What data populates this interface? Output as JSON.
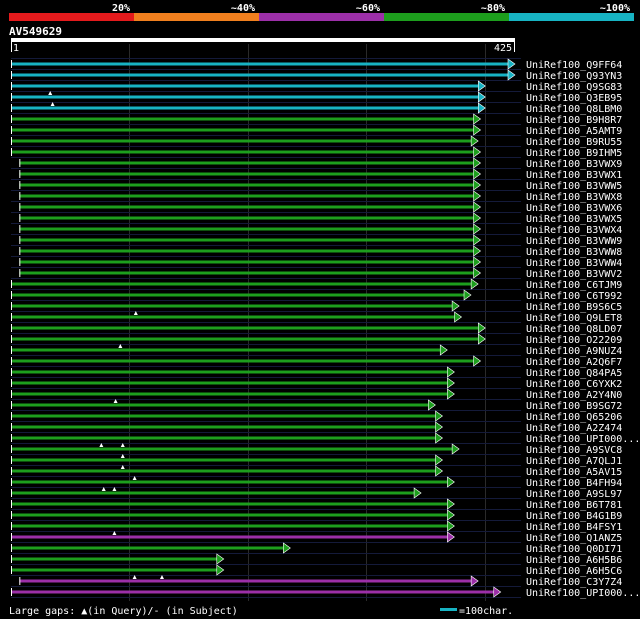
{
  "legend_scale": {
    "labels": [
      "20%",
      "~40%",
      "~60%",
      "~80%",
      "~100%"
    ],
    "colors": [
      "#e41a1c",
      "#f07f1e",
      "#9c2fa8",
      "#1d9e1d",
      "#17b3c3"
    ]
  },
  "query": {
    "id": "AV549629",
    "start_label": "1",
    "end_label": "425",
    "length": 425
  },
  "hits": [
    {
      "name": "UniRef100_Q9FF64",
      "start": 1,
      "end": 425,
      "color": "#17b3c3",
      "gaps": []
    },
    {
      "name": "UniRef100_Q93YN3",
      "start": 1,
      "end": 425,
      "color": "#17b3c3",
      "gaps": []
    },
    {
      "name": "UniRef100_Q9SG83",
      "start": 1,
      "end": 400,
      "color": "#17b3c3",
      "gaps": []
    },
    {
      "name": "UniRef100_Q3EB95",
      "start": 1,
      "end": 400,
      "color": "#17b3c3",
      "gaps": [
        34
      ]
    },
    {
      "name": "UniRef100_Q8LBM0",
      "start": 1,
      "end": 400,
      "color": "#17b3c3",
      "gaps": [
        36
      ]
    },
    {
      "name": "UniRef100_B9H8R7",
      "start": 1,
      "end": 396,
      "color": "#1d9e1d",
      "gaps": []
    },
    {
      "name": "UniRef100_A5AMT9",
      "start": 1,
      "end": 396,
      "color": "#1d9e1d",
      "gaps": []
    },
    {
      "name": "UniRef100_B9RU55",
      "start": 1,
      "end": 394,
      "color": "#1d9e1d",
      "gaps": []
    },
    {
      "name": "UniRef100_B9IHM5",
      "start": 1,
      "end": 396,
      "color": "#1d9e1d",
      "gaps": []
    },
    {
      "name": "UniRef100_B3VWX9",
      "start": 8,
      "end": 396,
      "color": "#1d9e1d",
      "gaps": []
    },
    {
      "name": "UniRef100_B3VWX1",
      "start": 8,
      "end": 396,
      "color": "#1d9e1d",
      "gaps": []
    },
    {
      "name": "UniRef100_B3VWW5",
      "start": 8,
      "end": 396,
      "color": "#1d9e1d",
      "gaps": []
    },
    {
      "name": "UniRef100_B3VWX8",
      "start": 8,
      "end": 396,
      "color": "#1d9e1d",
      "gaps": []
    },
    {
      "name": "UniRef100_B3VWX6",
      "start": 8,
      "end": 396,
      "color": "#1d9e1d",
      "gaps": []
    },
    {
      "name": "UniRef100_B3VWX5",
      "start": 8,
      "end": 396,
      "color": "#1d9e1d",
      "gaps": []
    },
    {
      "name": "UniRef100_B3VWX4",
      "start": 8,
      "end": 396,
      "color": "#1d9e1d",
      "gaps": []
    },
    {
      "name": "UniRef100_B3VWW9",
      "start": 8,
      "end": 396,
      "color": "#1d9e1d",
      "gaps": []
    },
    {
      "name": "UniRef100_B3VWW8",
      "start": 8,
      "end": 396,
      "color": "#1d9e1d",
      "gaps": []
    },
    {
      "name": "UniRef100_B3VWW4",
      "start": 8,
      "end": 396,
      "color": "#1d9e1d",
      "gaps": []
    },
    {
      "name": "UniRef100_B3VWV2",
      "start": 8,
      "end": 396,
      "color": "#1d9e1d",
      "gaps": []
    },
    {
      "name": "UniRef100_C6TJM9",
      "start": 1,
      "end": 394,
      "color": "#1d9e1d",
      "gaps": []
    },
    {
      "name": "UniRef100_C6T992",
      "start": 1,
      "end": 388,
      "color": "#1d9e1d",
      "gaps": []
    },
    {
      "name": "UniRef100_B9S6C5",
      "start": 1,
      "end": 378,
      "color": "#1d9e1d",
      "gaps": []
    },
    {
      "name": "UniRef100_Q9LET8",
      "start": 1,
      "end": 380,
      "color": "#1d9e1d",
      "gaps": [
        106
      ]
    },
    {
      "name": "UniRef100_Q8LD07",
      "start": 1,
      "end": 400,
      "color": "#1d9e1d",
      "gaps": []
    },
    {
      "name": "UniRef100_O22209",
      "start": 1,
      "end": 400,
      "color": "#1d9e1d",
      "gaps": []
    },
    {
      "name": "UniRef100_A9NUZ4",
      "start": 1,
      "end": 368,
      "color": "#1d9e1d",
      "gaps": [
        93
      ]
    },
    {
      "name": "UniRef100_A2Q6F7",
      "start": 1,
      "end": 396,
      "color": "#1d9e1d",
      "gaps": []
    },
    {
      "name": "UniRef100_Q84PA5",
      "start": 1,
      "end": 374,
      "color": "#1d9e1d",
      "gaps": []
    },
    {
      "name": "UniRef100_C6YXK2",
      "start": 1,
      "end": 374,
      "color": "#1d9e1d",
      "gaps": []
    },
    {
      "name": "UniRef100_A2Y4N0",
      "start": 1,
      "end": 374,
      "color": "#1d9e1d",
      "gaps": []
    },
    {
      "name": "UniRef100_B9SG72",
      "start": 1,
      "end": 358,
      "color": "#1d9e1d",
      "gaps": [
        89
      ]
    },
    {
      "name": "UniRef100_Q65206",
      "start": 1,
      "end": 364,
      "color": "#1d9e1d",
      "gaps": []
    },
    {
      "name": "UniRef100_A2Z474",
      "start": 1,
      "end": 364,
      "color": "#1d9e1d",
      "gaps": []
    },
    {
      "name": "UniRef100_UPI000...",
      "start": 1,
      "end": 364,
      "color": "#1d9e1d",
      "gaps": []
    },
    {
      "name": "UniRef100_A9SVC8",
      "start": 1,
      "end": 378,
      "color": "#1d9e1d",
      "gaps": [
        77,
        95
      ]
    },
    {
      "name": "UniRef100_A7QLJ1",
      "start": 1,
      "end": 364,
      "color": "#1d9e1d",
      "gaps": [
        95
      ]
    },
    {
      "name": "UniRef100_A5AV15",
      "start": 1,
      "end": 364,
      "color": "#1d9e1d",
      "gaps": [
        95
      ]
    },
    {
      "name": "UniRef100_B4FH94",
      "start": 1,
      "end": 374,
      "color": "#1d9e1d",
      "gaps": [
        105
      ]
    },
    {
      "name": "UniRef100_A9SL97",
      "start": 1,
      "end": 346,
      "color": "#1d9e1d",
      "gaps": [
        79,
        88
      ]
    },
    {
      "name": "UniRef100_B6T781",
      "start": 1,
      "end": 374,
      "color": "#1d9e1d",
      "gaps": []
    },
    {
      "name": "UniRef100_B4G1B9",
      "start": 1,
      "end": 374,
      "color": "#1d9e1d",
      "gaps": []
    },
    {
      "name": "UniRef100_B4FSY1",
      "start": 1,
      "end": 374,
      "color": "#1d9e1d",
      "gaps": []
    },
    {
      "name": "UniRef100_Q1ANZ5",
      "start": 1,
      "end": 374,
      "color": "#9c2fa8",
      "gaps": [
        88
      ]
    },
    {
      "name": "UniRef100_Q0DI71",
      "start": 1,
      "end": 236,
      "color": "#1d9e1d",
      "gaps": []
    },
    {
      "name": "UniRef100_A6H5B6",
      "start": 1,
      "end": 180,
      "color": "#1d9e1d",
      "gaps": []
    },
    {
      "name": "UniRef100_A6H5C6",
      "start": 1,
      "end": 180,
      "color": "#1d9e1d",
      "gaps": []
    },
    {
      "name": "UniRef100_C3Y7Z4",
      "start": 8,
      "end": 394,
      "color": "#9c2fa8",
      "gaps": [
        105,
        128
      ]
    },
    {
      "name": "UniRef100_UPI000...",
      "start": 1,
      "end": 413,
      "color": "#9c2fa8",
      "gaps": []
    }
  ],
  "footer": {
    "gaps_prefix": "Large gaps: ",
    "gaps_middle": "(in Query)/- (in Subject)",
    "scale_label": "=100char."
  },
  "colors": {
    "background": "#000000",
    "text": "#ffffff",
    "grid": "#2a2a2a",
    "query_bar": "#ffffff",
    "scale_key": "#17b3c3"
  }
}
